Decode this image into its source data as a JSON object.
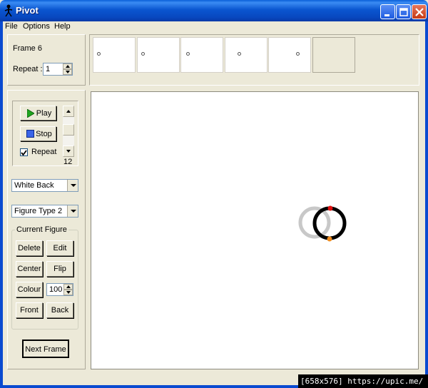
{
  "window": {
    "title": "Pivot"
  },
  "menu": {
    "items": [
      "File",
      "Options",
      "Help"
    ]
  },
  "frame_panel": {
    "frame_label": "Frame 6",
    "repeat_label": "Repeat :",
    "repeat_value": "1"
  },
  "playback": {
    "play_label": "Play",
    "stop_label": "Stop",
    "repeat_checkbox_label": "Repeat",
    "repeat_checked": true,
    "speed_value": "12"
  },
  "background_select": {
    "selected": "White Back"
  },
  "figure_type_select": {
    "selected": "Figure Type 2"
  },
  "current_figure": {
    "title": "Current Figure",
    "delete_label": "Delete",
    "edit_label": "Edit",
    "center_label": "Center",
    "flip_label": "Flip",
    "colour_label": "Colour",
    "colour_value": "100",
    "front_label": "Front",
    "back_label": "Back"
  },
  "next_frame_label": "Next Frame",
  "watermark": "[658x576] https://upic.me/",
  "colors": {
    "titlebar": "#0a56d0",
    "face": "#ece9d8",
    "handle_red": "#e01010",
    "handle_orange": "#f08c1e",
    "ghost": "#c8c8c8"
  }
}
